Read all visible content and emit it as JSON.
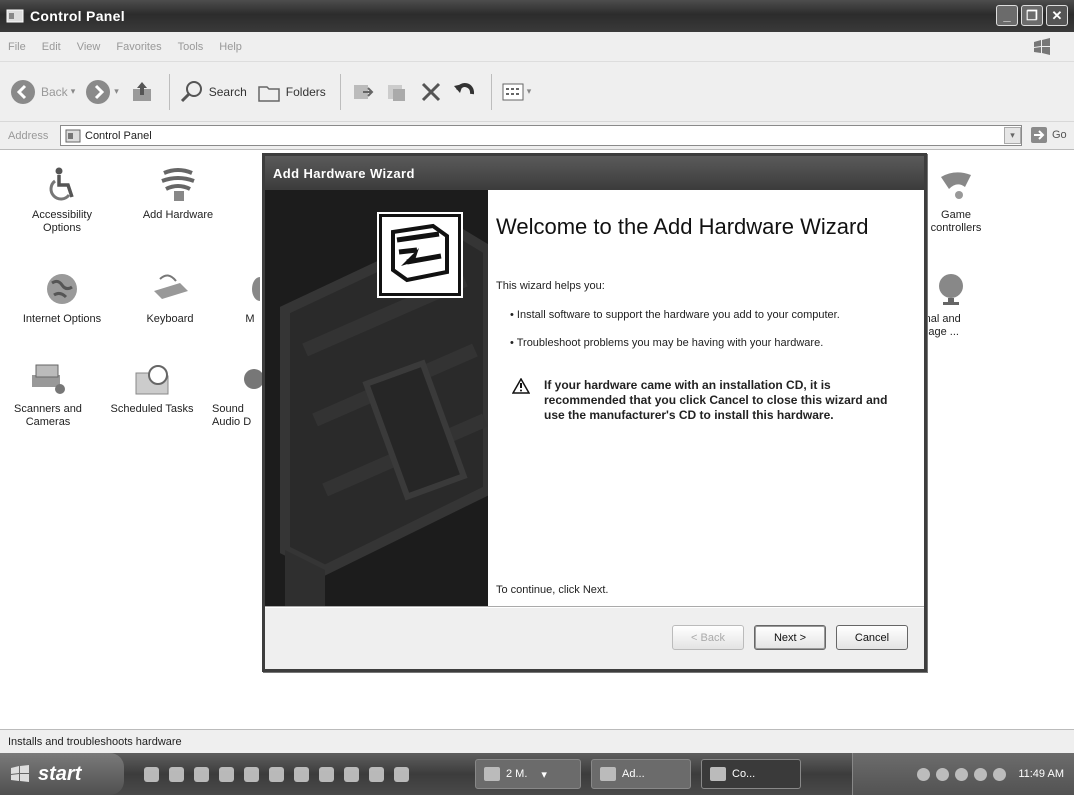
{
  "window": {
    "title": "Control Panel"
  },
  "menu": [
    "File",
    "Edit",
    "View",
    "Favorites",
    "Tools",
    "Help"
  ],
  "toolbar": {
    "back": "Back",
    "search": "Search",
    "folders": "Folders"
  },
  "address": {
    "label": "Address",
    "value": "Control Panel",
    "go": "Go"
  },
  "items": [
    {
      "label": "Accessibility Options",
      "icon": "accessibility-icon"
    },
    {
      "label": "Add Hardware",
      "icon": "add-hardware-icon"
    },
    {
      "label": "Game Controllers",
      "icon": "game-controller-icon",
      "visible_text": "Game\ncontrollers"
    },
    {
      "label": "Internet Options",
      "icon": "globe-icon"
    },
    {
      "label": "Keyboard",
      "icon": "keyboard-icon"
    },
    {
      "label": "Regional and Language ...",
      "icon": "regional-globe-icon",
      "visible_text": "gional and\nnguage ..."
    },
    {
      "label": "Scanners and Cameras",
      "icon": "scanner-icon"
    },
    {
      "label": "Scheduled Tasks",
      "icon": "scheduled-tasks-icon"
    },
    {
      "label": "Sounds and Audio Devices",
      "icon": "sound-icon",
      "visible_text": "Sound\nAudio D"
    },
    {
      "label": "Mouse",
      "icon": "mouse-icon",
      "visible_text": "M"
    }
  ],
  "status": "Installs and troubleshoots hardware",
  "wizard": {
    "title": "Add Hardware Wizard",
    "heading": "Welcome to the Add Hardware Wizard",
    "intro": "This wizard helps you:",
    "bullets": [
      "Install software to support the hardware you add to your computer.",
      "Troubleshoot problems you may be having with your hardware."
    ],
    "warning": "If your hardware came with an installation CD, it is recommended that you click Cancel to close this wizard and use the manufacturer's CD to install this hardware.",
    "continue": "To continue, click Next.",
    "buttons": {
      "back": "< Back",
      "next": "Next >",
      "cancel": "Cancel"
    }
  },
  "taskbar": {
    "start": "start",
    "tasks": [
      "2 M.",
      "Ad...",
      "Co..."
    ],
    "clock": "11:49 AM"
  }
}
